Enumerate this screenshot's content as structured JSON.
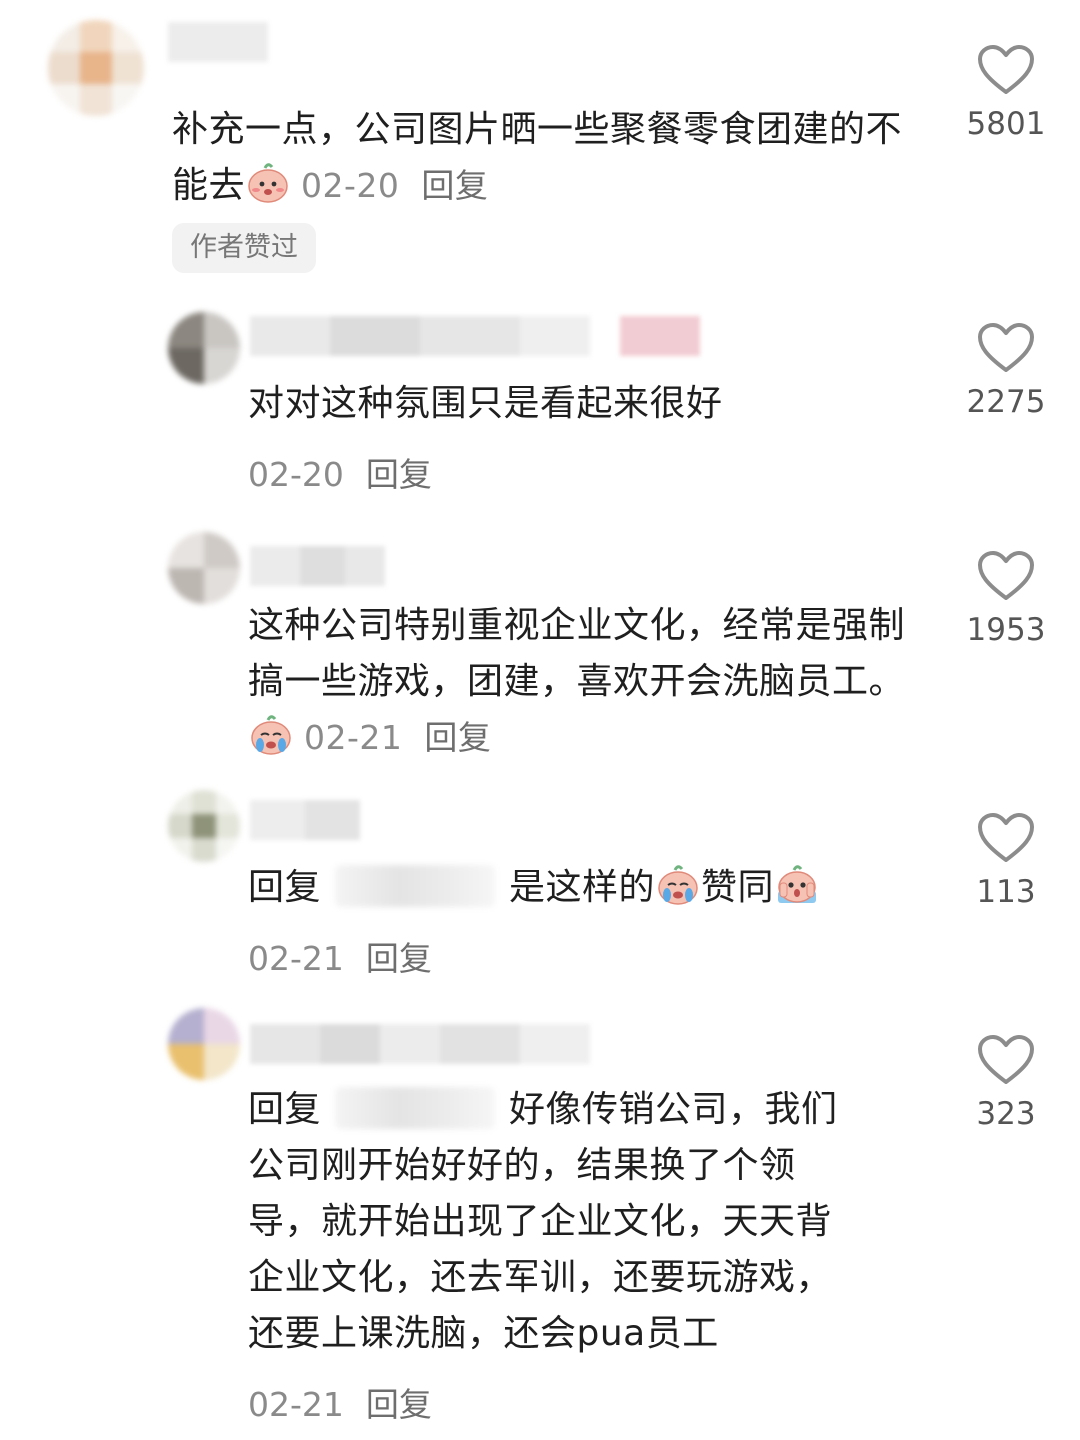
{
  "comments": [
    {
      "text": "补充一点，公司图片晒一些聚餐零食团建的不能去",
      "emoji": "blushing-bun-emoji",
      "date": "02-20",
      "reply_label": "回复",
      "badge": "作者赞过",
      "likes": "5801"
    },
    {
      "text": "对对这种氛围只是看起来很好",
      "date": "02-20",
      "reply_label": "回复",
      "likes": "2275"
    },
    {
      "text": "这种公司特别重视企业文化，经常是强制搞一些游戏，团建，喜欢开会洗脑员工。",
      "emoji": "crying-bun-emoji",
      "date": "02-21",
      "reply_label": "回复",
      "likes": "1953"
    },
    {
      "prefix": "回复",
      "text": "是这样的",
      "emoji": "crying-bun-emoji",
      "text2": "赞同",
      "emoji2": "scared-bun-emoji",
      "date": "02-21",
      "reply_label": "回复",
      "likes": "113"
    },
    {
      "prefix": "回复",
      "text": "好像传销公司，我们",
      "lines": [
        "公司刚开始好好的，结果换了个领",
        "导，就开始出现了企业文化，天天背",
        "企业文化，还去军训，还要玩游戏，",
        "还要上课洗脑，还会pua员工"
      ],
      "date": "02-21",
      "reply_label": "回复",
      "likes": "323"
    }
  ],
  "colors": {
    "text": "#1f1f1f",
    "meta": "#8a8a8a",
    "badge_bg": "#f2f2f2",
    "heart": "#8c8c8c"
  },
  "icons": [
    "heart-icon",
    "blushing-bun-emoji",
    "crying-bun-emoji",
    "scared-bun-emoji"
  ]
}
